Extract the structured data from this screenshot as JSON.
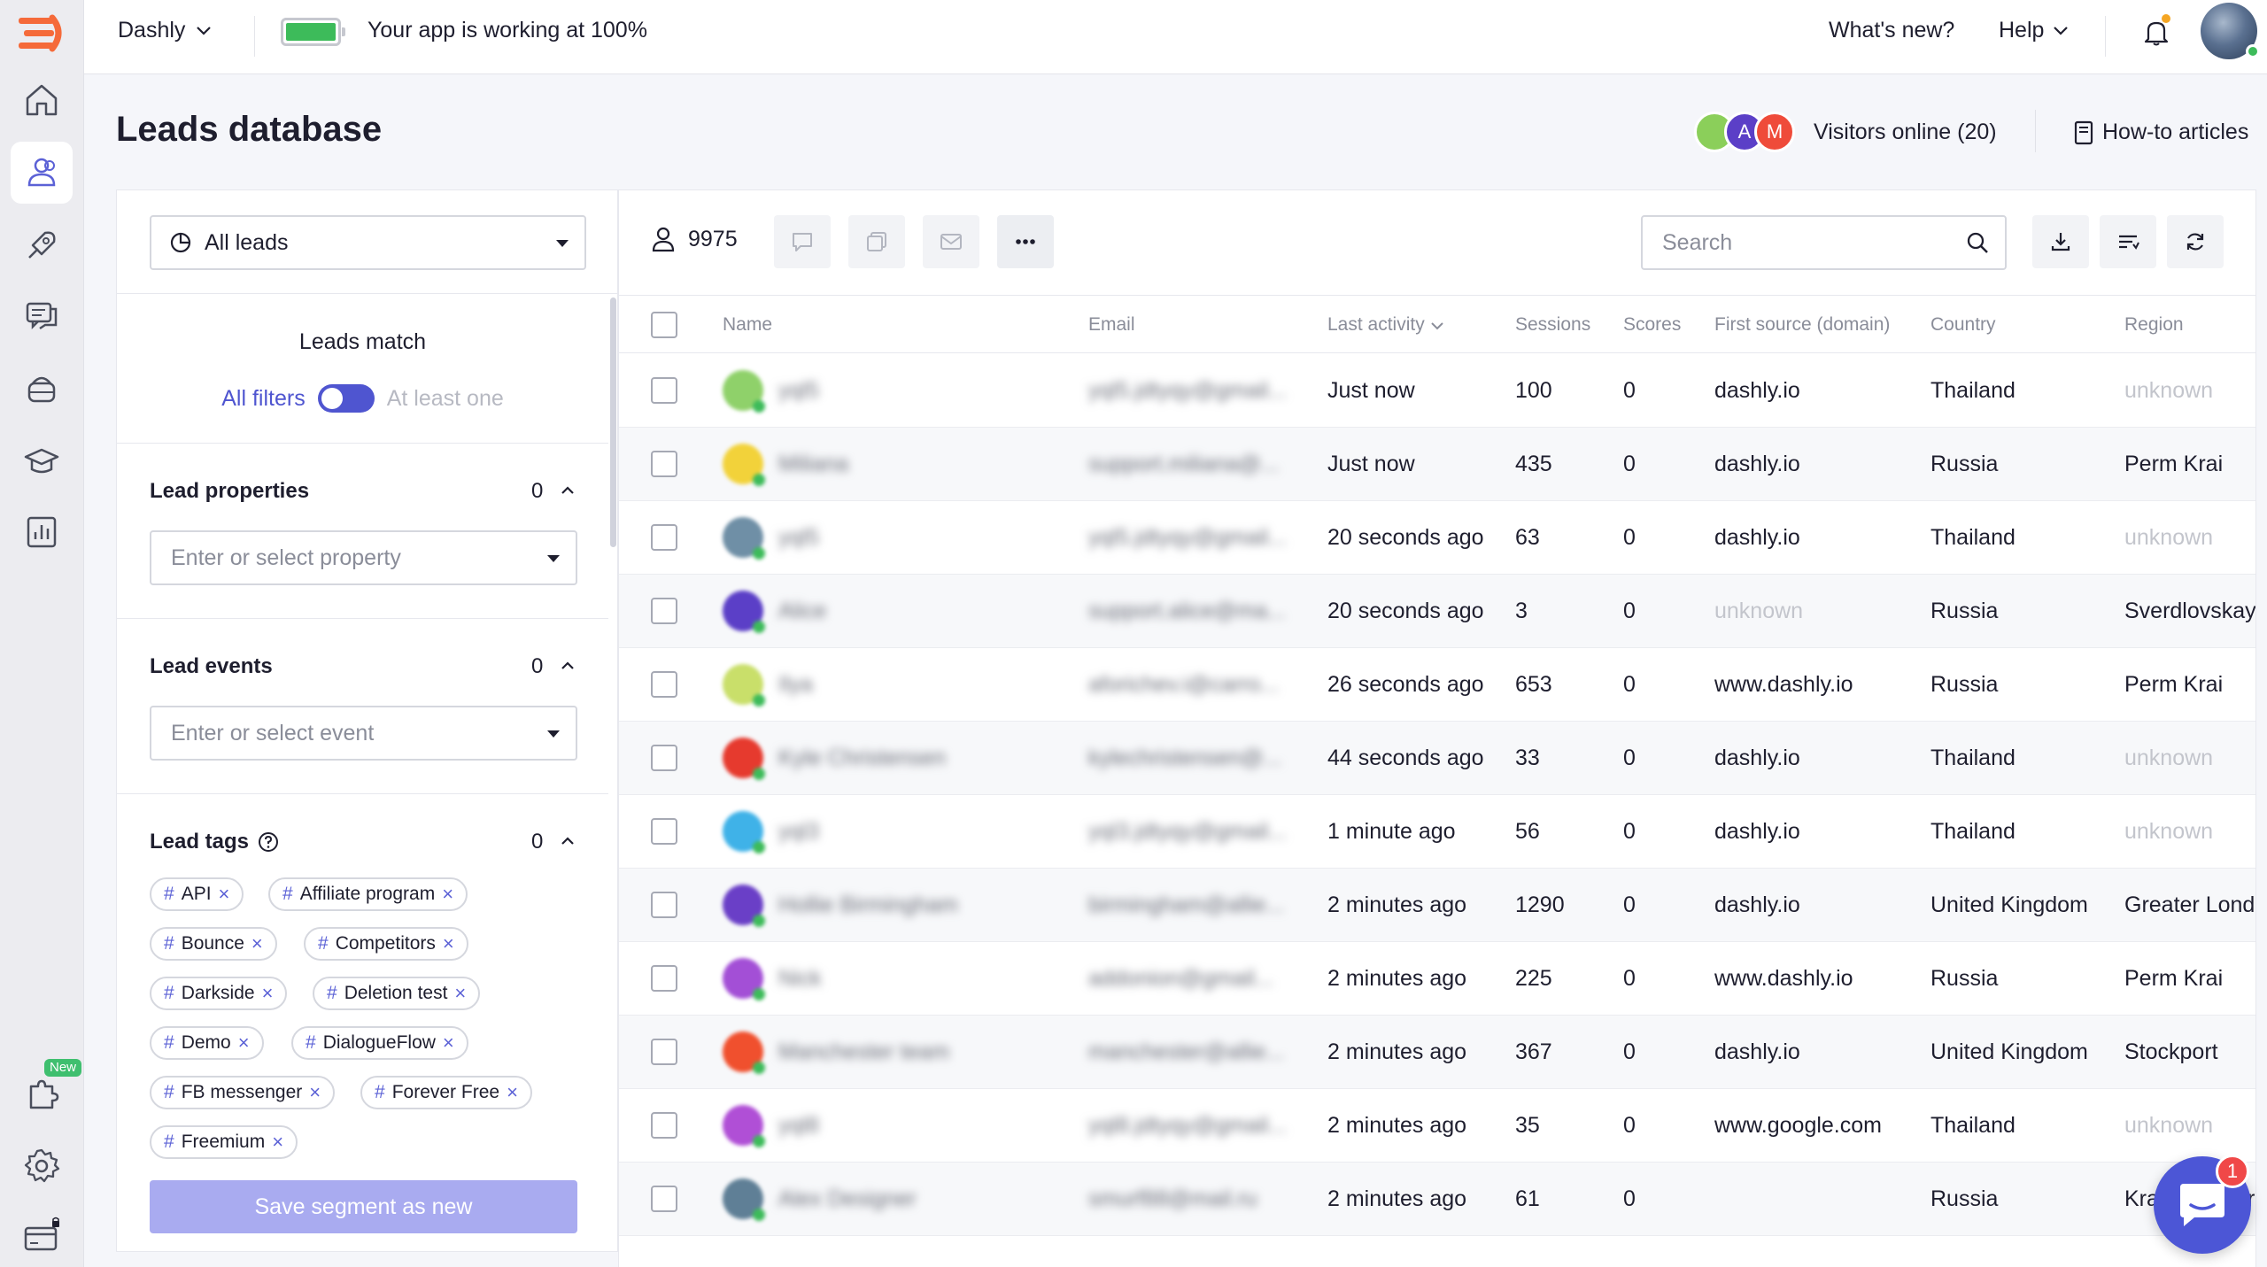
{
  "topbar": {
    "project": "Dashly",
    "status_text": "Your app is working at 100%",
    "whats_new": "What's new?",
    "help": "Help",
    "battery_level": 1.0
  },
  "header": {
    "title": "Leads database",
    "visitors_label": "Visitors online (20)",
    "visitor_avatars": [
      {
        "initial": "",
        "color": "#8bcf5a"
      },
      {
        "initial": "A",
        "color": "#5b3fc7"
      },
      {
        "initial": "M",
        "color": "#ef4b3a"
      }
    ],
    "howto_label": "How-to articles"
  },
  "filters": {
    "segment": "All leads",
    "match_title": "Leads match",
    "all_filters": "All filters",
    "at_least_one": "At least one",
    "properties": {
      "title": "Lead properties",
      "count": "0",
      "placeholder": "Enter or select property"
    },
    "events": {
      "title": "Lead events",
      "count": "0",
      "placeholder": "Enter or select event"
    },
    "tags": {
      "title": "Lead tags",
      "count": "0",
      "items": [
        "API",
        "Affiliate program",
        "Bounce",
        "Competitors",
        "Darkside",
        "Deletion test",
        "Demo",
        "DialogueFlow",
        "FB messenger",
        "Forever Free",
        "Freemium"
      ]
    },
    "save_button": "Save segment as new"
  },
  "table": {
    "lead_count": "9975",
    "search_placeholder": "Search",
    "columns": {
      "name": "Name",
      "email": "Email",
      "last_activity": "Last activity",
      "sessions": "Sessions",
      "scores": "Scores",
      "source": "First source (domain)",
      "country": "Country",
      "region": "Region"
    },
    "rows": [
      {
        "name": "yql5",
        "email": "yql5.jdtyqy@gmail...",
        "activity": "Just now",
        "sessions": "100",
        "scores": "0",
        "source": "dashly.io",
        "country": "Thailand",
        "region": "unknown",
        "avatar": "#8fd16a"
      },
      {
        "name": "Miliana",
        "email": "support.miliana@...",
        "activity": "Just now",
        "sessions": "435",
        "scores": "0",
        "source": "dashly.io",
        "country": "Russia",
        "region": "Perm Krai",
        "avatar": "#f2d23a"
      },
      {
        "name": "yql5",
        "email": "yql5.jdtyqy@gmail...",
        "activity": "20 seconds ago",
        "sessions": "63",
        "scores": "0",
        "source": "dashly.io",
        "country": "Thailand",
        "region": "unknown",
        "avatar": "#6f8fa6"
      },
      {
        "name": "Alice",
        "email": "support.alice@ma...",
        "activity": "20 seconds ago",
        "sessions": "3",
        "scores": "0",
        "source": "unknown",
        "country": "Russia",
        "region": "Sverdlovskaya",
        "avatar": "#5b3fc7"
      },
      {
        "name": "Ilya",
        "email": "aforichev.i@carro...",
        "activity": "26 seconds ago",
        "sessions": "653",
        "scores": "0",
        "source": "www.dashly.io",
        "country": "Russia",
        "region": "Perm Krai",
        "avatar": "#c9df6a"
      },
      {
        "name": "Kyle Christensen",
        "email": "kylechristensen@...",
        "activity": "44 seconds ago",
        "sessions": "33",
        "scores": "0",
        "source": "dashly.io",
        "country": "Thailand",
        "region": "unknown",
        "avatar": "#e63a2e"
      },
      {
        "name": "yql3",
        "email": "yql3.jdtyqy@gmail...",
        "activity": "1 minute ago",
        "sessions": "56",
        "scores": "0",
        "source": "dashly.io",
        "country": "Thailand",
        "region": "unknown",
        "avatar": "#3fb2e8"
      },
      {
        "name": "Hollie Birmingham",
        "email": "birmingham@allie...",
        "activity": "2 minutes ago",
        "sessions": "1290",
        "scores": "0",
        "source": "dashly.io",
        "country": "United Kingdom",
        "region": "Greater London",
        "avatar": "#6a3fc7"
      },
      {
        "name": "Nick",
        "email": "addonion@gmail...",
        "activity": "2 minutes ago",
        "sessions": "225",
        "scores": "0",
        "source": "www.dashly.io",
        "country": "Russia",
        "region": "Perm Krai",
        "avatar": "#a34fd6"
      },
      {
        "name": "Manchester team",
        "email": "manchester@allie...",
        "activity": "2 minutes ago",
        "sessions": "367",
        "scores": "0",
        "source": "dashly.io",
        "country": "United Kingdom",
        "region": "Stockport",
        "avatar": "#f0502e"
      },
      {
        "name": "yql8",
        "email": "yql8.jdtyqy@gmail...",
        "activity": "2 minutes ago",
        "sessions": "35",
        "scores": "0",
        "source": "www.google.com",
        "country": "Thailand",
        "region": "unknown",
        "avatar": "#b04fd6"
      },
      {
        "name": "Alex Designer",
        "email": "smurf88@mail.ru",
        "activity": "2 minutes ago",
        "sessions": "61",
        "scores": "0",
        "source": "",
        "country": "Russia",
        "region": "Krasnodar Krai",
        "avatar": "#5f7f96"
      }
    ]
  },
  "sidebar": {
    "items": [
      "home-icon",
      "users-icon",
      "rocket-icon",
      "chat-icon",
      "bot-icon",
      "academy-icon",
      "reports-icon"
    ],
    "bottom": [
      "integrations-icon",
      "settings-icon",
      "billing-icon"
    ],
    "new_badge": "New"
  },
  "chat": {
    "unread": "1"
  },
  "colors": {
    "accent": "#4f55d0",
    "brand": "#f56a3a",
    "online": "#3dbb5a"
  }
}
